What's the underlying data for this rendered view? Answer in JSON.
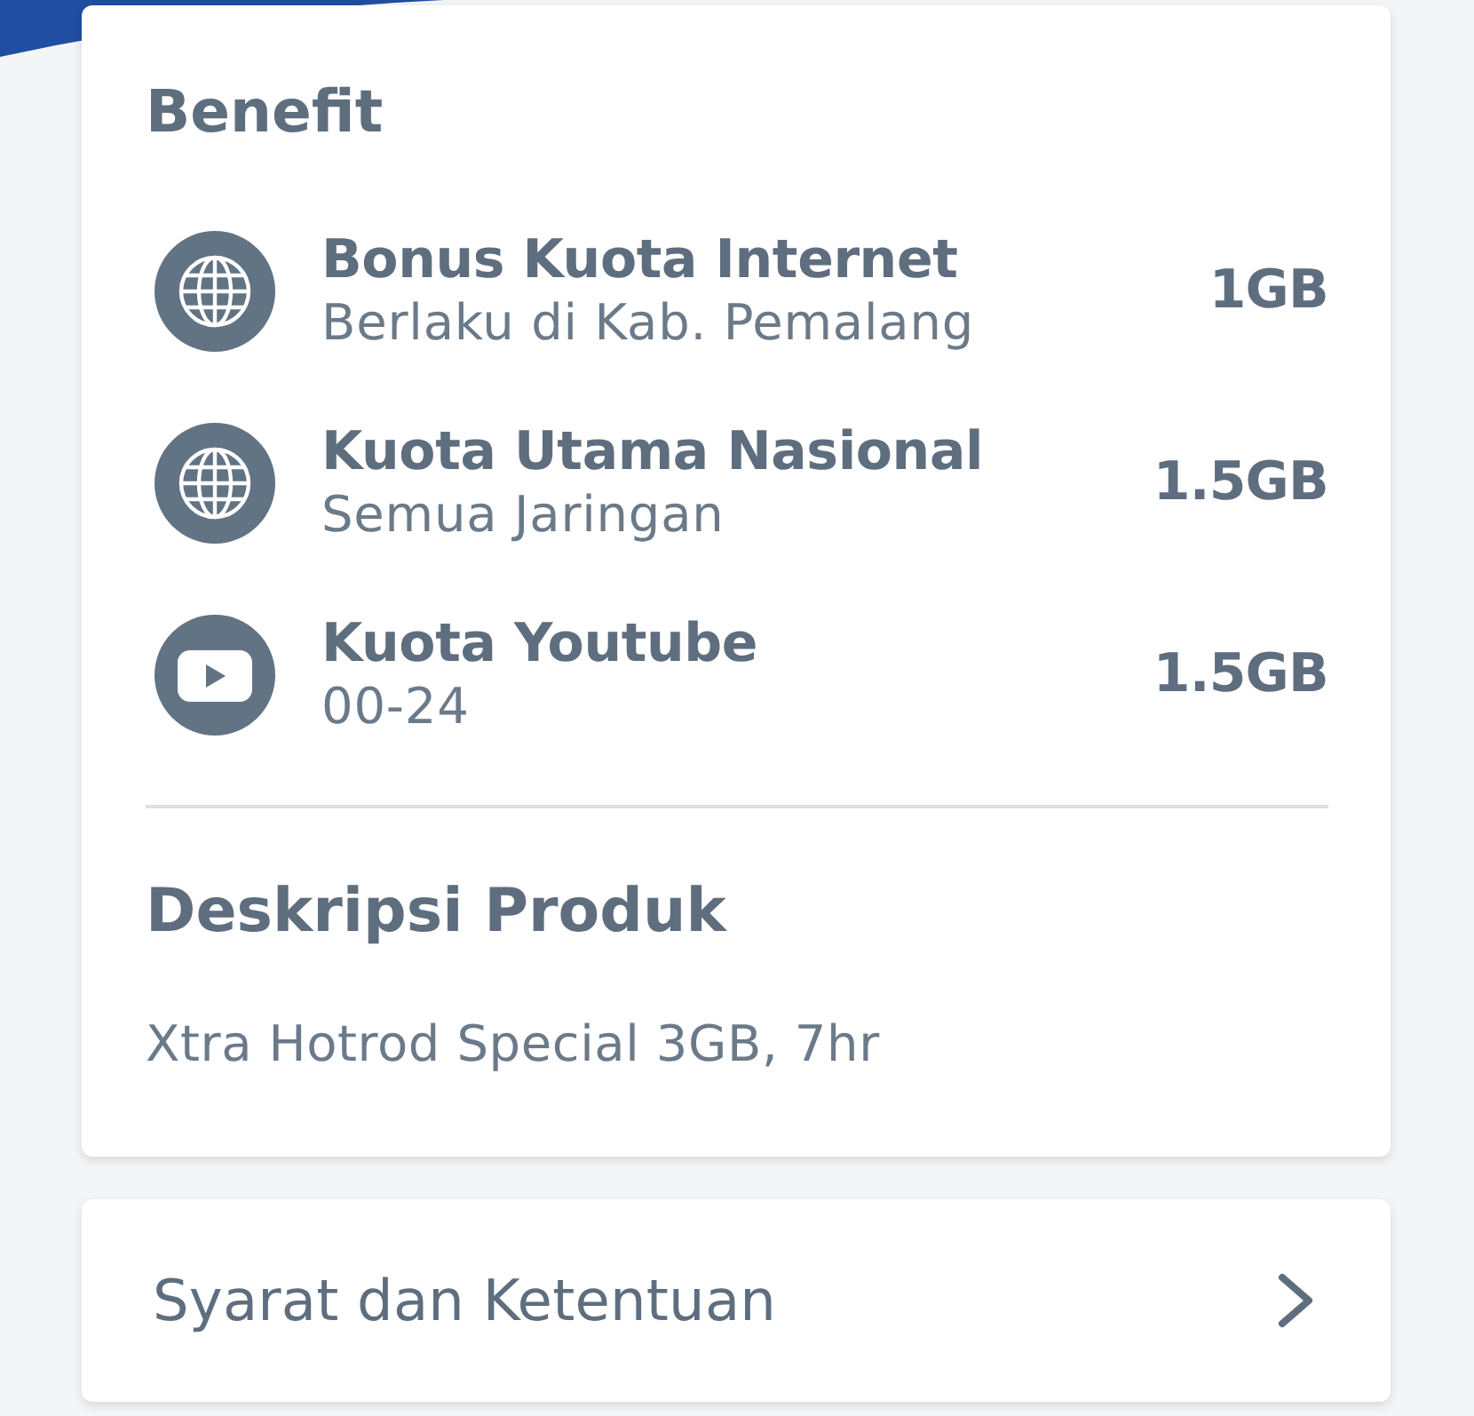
{
  "benefit": {
    "title": "Benefit",
    "items": [
      {
        "kind": "internet",
        "title": "Bonus Kuota Internet",
        "subtitle": "Berlaku di Kab. Pemalang",
        "amount": "1GB"
      },
      {
        "kind": "internet",
        "title": "Kuota Utama Nasional",
        "subtitle": "Semua Jaringan",
        "amount": "1.5GB"
      },
      {
        "kind": "video",
        "title": "Kuota Youtube",
        "subtitle": "00-24",
        "amount": "1.5GB"
      }
    ]
  },
  "description": {
    "title": "Deskripsi Produk",
    "text": "Xtra Hotrod Special 3GB, 7hr"
  },
  "terms": {
    "label": "Syarat dan Ketentuan"
  }
}
